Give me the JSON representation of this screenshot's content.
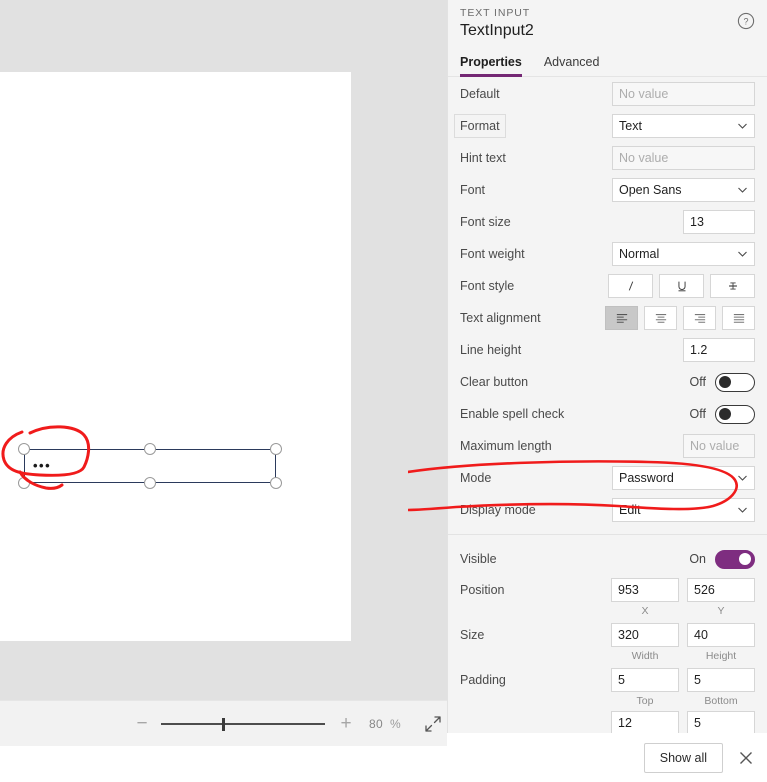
{
  "panel": {
    "kicker": "TEXT INPUT",
    "title": "TextInput2",
    "help_icon": "help-circle-icon",
    "tabs": [
      {
        "label": "Properties",
        "active": true
      },
      {
        "label": "Advanced",
        "active": false
      }
    ]
  },
  "properties": [
    {
      "label": "Default",
      "type": "text",
      "value": "",
      "placeholder": "No value"
    },
    {
      "label": "Format",
      "type": "select",
      "value": "Text"
    },
    {
      "label": "Hint text",
      "type": "text",
      "value": "",
      "placeholder": "No value"
    },
    {
      "label": "Font",
      "type": "select",
      "value": "Open Sans"
    },
    {
      "label": "Font size",
      "type": "number",
      "value": "13"
    },
    {
      "label": "Font weight",
      "type": "select",
      "value": "Normal"
    },
    {
      "label": "Font style",
      "type": "segmented",
      "options": [
        "italic",
        "underline",
        "strikethrough"
      ],
      "selected": -1
    },
    {
      "label": "Text alignment",
      "type": "segmented",
      "options": [
        "align-left",
        "align-center",
        "align-right",
        "align-justify"
      ],
      "selected": 0
    },
    {
      "label": "Line height",
      "type": "number",
      "value": "1.2"
    },
    {
      "label": "Clear button",
      "type": "toggle",
      "value": "Off",
      "on": false
    },
    {
      "label": "Enable spell check",
      "type": "toggle",
      "value": "Off",
      "on": false
    },
    {
      "label": "Maximum length",
      "type": "text",
      "value": "",
      "placeholder": "No value"
    },
    {
      "label": "Mode",
      "type": "select",
      "value": "Password",
      "annotated": true
    },
    {
      "label": "Display mode",
      "type": "select",
      "value": "Edit"
    }
  ],
  "layout_section": {
    "visible": {
      "label": "Visible",
      "state": "On",
      "on": true
    },
    "position": {
      "label": "Position",
      "x": {
        "value": "953",
        "caption": "X"
      },
      "y": {
        "value": "526",
        "caption": "Y"
      }
    },
    "size": {
      "label": "Size",
      "width": {
        "value": "320",
        "caption": "Width"
      },
      "height": {
        "value": "40",
        "caption": "Height"
      }
    },
    "padding": {
      "label": "Padding",
      "top": {
        "value": "5",
        "caption": "Top"
      },
      "bottom": {
        "value": "5",
        "caption": "Bottom"
      },
      "left": {
        "value": "12"
      },
      "right": {
        "value": "5"
      }
    }
  },
  "footer": {
    "show_all_label": "Show all",
    "close_icon": "close-icon"
  },
  "canvas": {
    "control_text": "•••",
    "annotation_color": "#f01b1b"
  },
  "zoom_toolbar": {
    "minus": "−",
    "plus": "+",
    "value": "80",
    "unit": "%",
    "fit_icon": "fit-screen-icon",
    "slider_position_percent": 38
  },
  "colors": {
    "accent_purple": "#742774",
    "toggle_on": "#7e2d80",
    "panel_bg": "#f4f4f4",
    "canvas_bg": "#e1e1e1",
    "control_border": "#2b3a5c",
    "annotation_red": "#f01b1b"
  }
}
